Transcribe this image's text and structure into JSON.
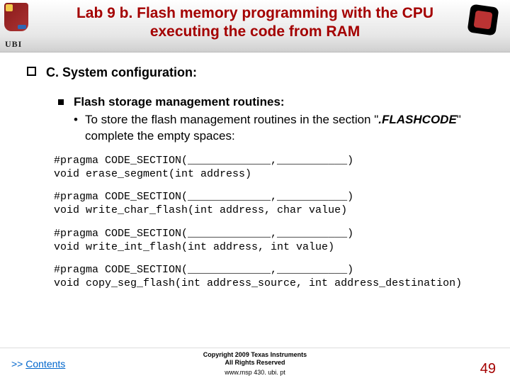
{
  "header": {
    "title": "Lab 9 b. Flash memory programming with the CPU executing the code from RAM",
    "ubi_label": "UBI"
  },
  "section": {
    "heading": "C. System configuration:",
    "sub_heading": "Flash storage management routines:",
    "sub_bullet_pre": "To store the flash management routines in the section \"",
    "sub_bullet_em": ".FLASHCODE",
    "sub_bullet_post": "\" complete the empty spaces:"
  },
  "code": {
    "b1l1": "#pragma CODE_SECTION(_____________,___________)",
    "b1l2": "void erase_segment(int address)",
    "b2l1": "#pragma CODE_SECTION(_____________,___________)",
    "b2l2": "void write_char_flash(int address, char value)",
    "b3l1": "#pragma CODE_SECTION(_____________,___________)",
    "b3l2": "void write_int_flash(int address, int value)",
    "b4l1": "#pragma CODE_SECTION(_____________,___________)",
    "b4l2": "void copy_seg_flash(int address_source, int address_destination)"
  },
  "footer": {
    "arrows": ">>",
    "contents": "Contents",
    "copyright_line1": "Copyright  2009 Texas Instruments",
    "copyright_line2": "All Rights Reserved",
    "url": "www.msp 430. ubi. pt",
    "page": "49"
  }
}
